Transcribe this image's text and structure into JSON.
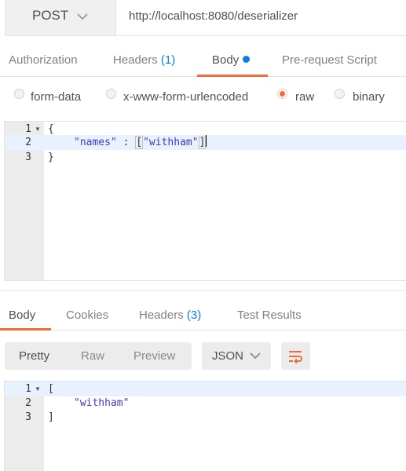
{
  "request": {
    "method": "POST",
    "url": "http://localhost:8080/deserializer",
    "tabs": {
      "authorization": "Authorization",
      "headers": "Headers",
      "headers_count": "(1)",
      "body": "Body",
      "prerequest": "Pre-request Script"
    },
    "body_types": {
      "form_data": "form-data",
      "urlencoded": "x-www-form-urlencoded",
      "raw": "raw",
      "binary": "binary"
    },
    "selected_body_type": "raw",
    "editor": {
      "line_numbers": [
        "1",
        "2",
        "3"
      ],
      "line1": "{",
      "key": "\"names\"",
      "colon": " : ",
      "open_bracket": "[",
      "value": "\"withham\"",
      "close_bracket": "]",
      "line3": "}"
    }
  },
  "response": {
    "tabs": {
      "body": "Body",
      "cookies": "Cookies",
      "headers": "Headers",
      "headers_count": "(3)",
      "test_results": "Test Results"
    },
    "view_modes": {
      "pretty": "Pretty",
      "raw": "Raw",
      "preview": "Preview"
    },
    "format": "JSON",
    "editor": {
      "line_numbers": [
        "1",
        "2",
        "3"
      ],
      "line1": "[",
      "value": "\"withham\"",
      "line3": "]"
    }
  },
  "colors": {
    "accent": "#f26b3a",
    "count_blue": "#097bed",
    "string": "#3c3cc7"
  }
}
